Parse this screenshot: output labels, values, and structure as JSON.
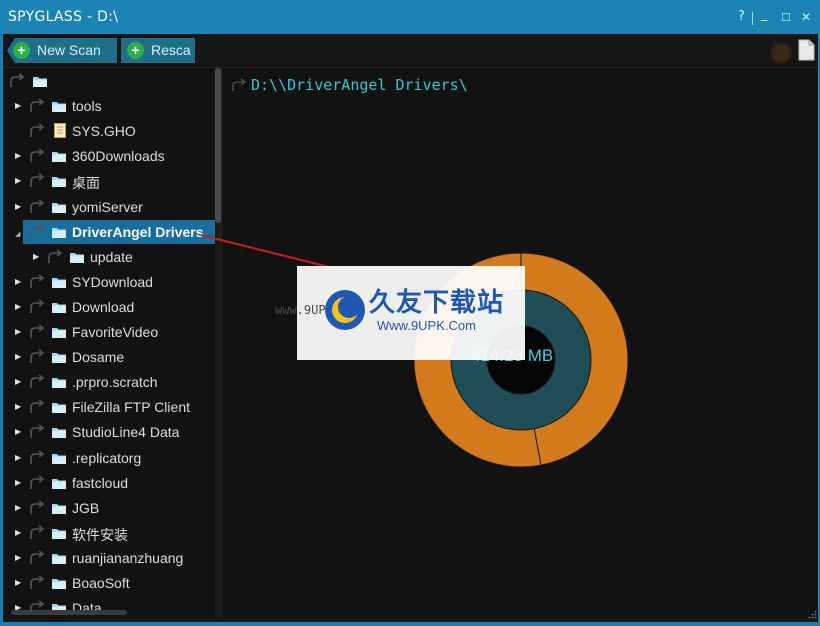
{
  "window": {
    "title": "SPYGLASS - D:\\",
    "controls": {
      "help": "?",
      "minimize": "_",
      "maximize": "☐",
      "close": "✕"
    },
    "accent_color": "#1a7fae"
  },
  "toolbar": {
    "new_scan_label": "New Scan",
    "rescan_label": "Resca",
    "icons": [
      "plus-icon",
      "plus-icon",
      "circle-icon",
      "document-icon"
    ]
  },
  "tree": {
    "root_label": "",
    "items": [
      {
        "label": "tools",
        "kind": "folder",
        "expandable": true
      },
      {
        "label": "SYS.GHO",
        "kind": "file",
        "expandable": false
      },
      {
        "label": "360Downloads",
        "kind": "folder",
        "expandable": true
      },
      {
        "label": "桌面",
        "kind": "folder",
        "expandable": true
      },
      {
        "label": "yomiServer",
        "kind": "folder",
        "expandable": true
      },
      {
        "label": "DriverAngel Drivers",
        "kind": "folder",
        "expandable": true,
        "selected": true,
        "expanded": true
      },
      {
        "label": "update",
        "kind": "folder",
        "expandable": true,
        "indent": 1
      },
      {
        "label": "SYDownload",
        "kind": "folder",
        "expandable": true
      },
      {
        "label": "Download",
        "kind": "folder",
        "expandable": true
      },
      {
        "label": "FavoriteVideo",
        "kind": "folder",
        "expandable": true
      },
      {
        "label": "Dosame",
        "kind": "folder",
        "expandable": true
      },
      {
        "label": ".prpro.scratch",
        "kind": "folder",
        "expandable": true
      },
      {
        "label": "FileZilla FTP Client",
        "kind": "folder",
        "expandable": true
      },
      {
        "label": "StudioLine4 Data",
        "kind": "folder",
        "expandable": true
      },
      {
        "label": ".replicatorg",
        "kind": "folder",
        "expandable": true
      },
      {
        "label": "fastcloud",
        "kind": "folder",
        "expandable": true
      },
      {
        "label": "JGB",
        "kind": "folder",
        "expandable": true
      },
      {
        "label": "软件安装",
        "kind": "folder",
        "expandable": true
      },
      {
        "label": "ruanjiananzhuang",
        "kind": "folder",
        "expandable": true
      },
      {
        "label": "BoaoSoft",
        "kind": "folder",
        "expandable": true
      },
      {
        "label": "Data",
        "kind": "folder",
        "expandable": true
      }
    ]
  },
  "main": {
    "path": "D:\\\\DriverAngel Drivers\\",
    "size_label": "414.23 MB"
  },
  "chart_data": {
    "type": "pie",
    "center_label": "414.23 MB",
    "rings": [
      {
        "name": "",
        "values": [
          1.0
        ],
        "color": "#1f4e56"
      },
      {
        "name": "",
        "values": [
          0.47,
          0.53
        ],
        "color": "#d27a1c"
      }
    ]
  },
  "watermark": {
    "url_left": "www.9UPK.com",
    "title": "久友下载站",
    "url": "Www.9UPK.Com"
  },
  "colors": {
    "background": "#121212",
    "selection": "#1a6e9b",
    "path_text": "#36c7dc",
    "ring_outer": "#d27a1c",
    "ring_inner": "#1f4e56",
    "button": "#1f6f8a",
    "plus": "#2bb04a"
  }
}
